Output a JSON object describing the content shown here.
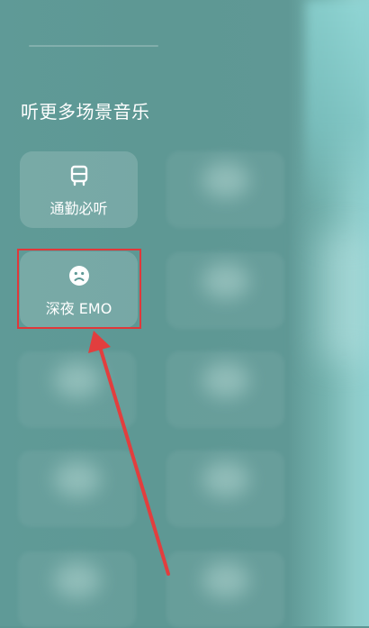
{
  "section": {
    "title": "听更多场景音乐"
  },
  "cards": [
    {
      "label": "通勤必听",
      "icon": "bus-icon"
    },
    {
      "label": "深夜 EMO",
      "icon": "sad-face-icon"
    }
  ],
  "colors": {
    "background": "#5f9a97",
    "card_background": "rgba(255,255,255,0.16)",
    "highlight_border": "#e0383a",
    "annotation_arrow": "#e23e3e",
    "text": "#ffffff"
  }
}
